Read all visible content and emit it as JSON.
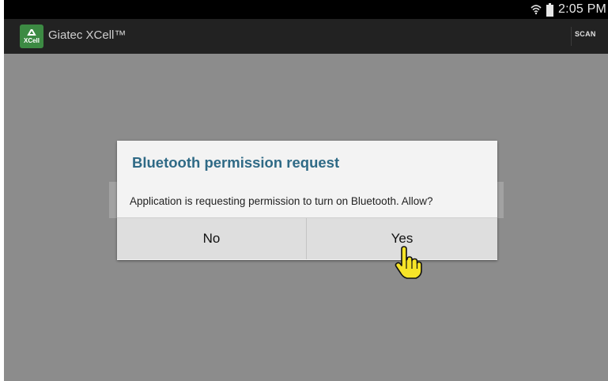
{
  "status_bar": {
    "time": "2:05 PM",
    "wifi_icon": "wifi-icon",
    "battery_icon": "battery-icon"
  },
  "action_bar": {
    "title": "Giatec XCell™",
    "logo_text": "XCell",
    "scan_label": "SCAN"
  },
  "dialog": {
    "title": "Bluetooth permission request",
    "message": "Application is requesting permission to turn on Bluetooth. Allow?",
    "no_label": "No",
    "yes_label": "Yes"
  },
  "colors": {
    "accent_title": "#2f6a86",
    "logo_green": "#3c8a43",
    "overlay": "#8c8c8c"
  }
}
